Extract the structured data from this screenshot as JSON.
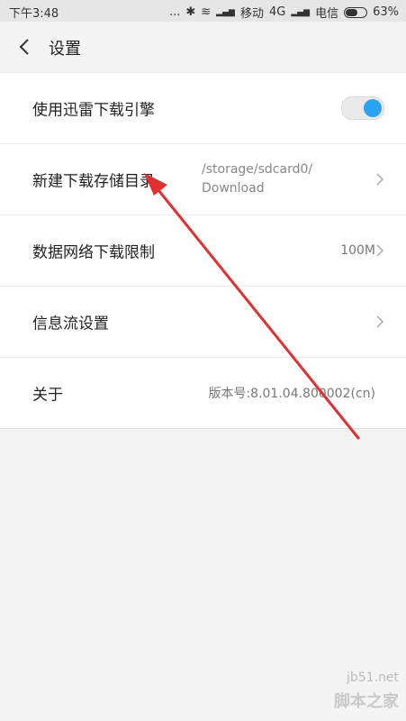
{
  "status_bar": {
    "time": "下午3:48",
    "dots": "...",
    "bluetooth": "✱",
    "wifi": "≋",
    "signal1_bars": "▂▄▆",
    "carrier1": "移动",
    "network_type": "4G",
    "signal2_bars": "▂▄▆",
    "carrier2": "电信",
    "battery_percent": "63%",
    "battery_level": 0.63
  },
  "header": {
    "title": "设置",
    "back_icon": "chevron-left-icon"
  },
  "settings": {
    "items": [
      {
        "label": "使用迅雷下载引擎",
        "control": "toggle",
        "enabled": true
      },
      {
        "label": "新建下载存储目录",
        "path_line1": "/storage/sdcard0/",
        "path_line2": "Download",
        "control": "chevron"
      },
      {
        "label": "数据网络下载限制",
        "value": "100M",
        "control": "chevron"
      },
      {
        "label": "信息流设置",
        "control": "chevron"
      },
      {
        "label": "关于",
        "value": "版本号:8.01.04.800002(cn)"
      }
    ]
  },
  "colors": {
    "accent": "#2aa3f0",
    "annotation_arrow": "#e03030",
    "background": "#f4f4f4",
    "list_background": "#ffffff"
  },
  "watermark": {
    "domain": "jb51.net",
    "site": "脚本之家"
  }
}
